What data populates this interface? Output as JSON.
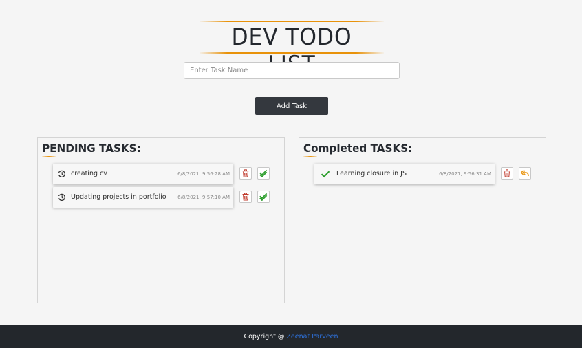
{
  "app": {
    "title": "DEV TODO LIST"
  },
  "input": {
    "placeholder": "Enter Task Name",
    "value": ""
  },
  "add_button": {
    "label": "Add Task"
  },
  "pending": {
    "title": "PENDING TASKS:",
    "tasks": [
      {
        "name": "creating cv",
        "time": "6/8/2021, 9:56:28 AM",
        "icon": "history-icon"
      },
      {
        "name": "Updating projects in portfolio",
        "time": "6/8/2021, 9:57:10 AM",
        "icon": "history-icon"
      }
    ]
  },
  "completed": {
    "title": "Completed TASKS:",
    "tasks": [
      {
        "name": "Learning closure in JS",
        "time": "6/8/2021, 9:56:31 AM",
        "icon": "check-icon"
      }
    ]
  },
  "footer": {
    "prefix": "Copyright @ ",
    "author": "Zeenat Parveen"
  },
  "colors": {
    "accent": "#e8920a",
    "delete": "#c0392b",
    "complete": "#2e9e2e",
    "undo": "#e8920a",
    "footer_bg": "#23272c",
    "link": "#2f74e0"
  }
}
